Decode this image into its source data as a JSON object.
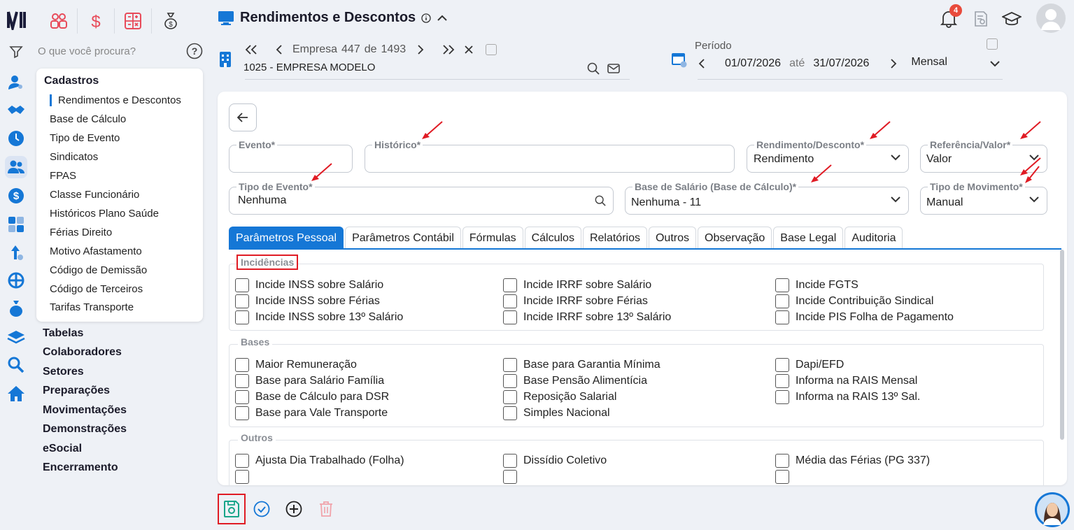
{
  "shortcuts": [
    {
      "name": "colaboradores-shortcut",
      "icon": "people-icon"
    },
    {
      "name": "financeiro-shortcut",
      "icon": "dollar-icon"
    },
    {
      "name": "calculadora-shortcut",
      "icon": "calculator-icon"
    },
    {
      "name": "money-bag-shortcut",
      "icon": "money-bag-icon"
    }
  ],
  "menu_search": {
    "placeholder": "O que você procura?"
  },
  "submenu": {
    "title": "Cadastros",
    "items": [
      "Rendimentos e Descontos",
      "Base de Cálculo",
      "Tipo de Evento",
      "Sindicatos",
      "FPAS",
      "Classe Funcionário",
      "Históricos Plano Saúde",
      "Férias Direito",
      "Motivo Afastamento",
      "Código de Demissão",
      "Código de Terceiros",
      "Tarifas Transporte"
    ]
  },
  "main_menu": [
    "Tabelas",
    "Colaboradores",
    "Setores",
    "Preparações",
    "Movimentações",
    "Demonstrações",
    "eSocial",
    "Encerramento"
  ],
  "header": {
    "title": "Rendimentos e Descontos",
    "notification_count": "4"
  },
  "empresa": {
    "label": "Empresa",
    "current": "447",
    "de": "de",
    "total": "1493",
    "name": "1025 - EMPRESA MODELO"
  },
  "periodo": {
    "label": "Período",
    "start": "01/07/2026",
    "ate": "até",
    "end": "31/07/2026",
    "mode": "Mensal"
  },
  "form": {
    "evento": {
      "label": "Evento*",
      "value": ""
    },
    "historico": {
      "label": "Histórico*",
      "value": ""
    },
    "rendimento_desconto": {
      "label": "Rendimento/Desconto*",
      "value": "Rendimento"
    },
    "referencia_valor": {
      "label": "Referência/Valor*",
      "value": "Valor"
    },
    "tipo_evento": {
      "label": "Tipo de Evento*",
      "value": "Nenhuma"
    },
    "base_salario": {
      "label": "Base de Salário (Base de Cálculo)*",
      "value": "Nenhuma - 11"
    },
    "tipo_movimento": {
      "label": "Tipo de Movimento*",
      "value": "Manual"
    }
  },
  "tabs": [
    "Parâmetros Pessoal",
    "Parâmetros Contábil",
    "Fórmulas",
    "Cálculos",
    "Relatórios",
    "Outros",
    "Observação",
    "Base Legal",
    "Auditoria"
  ],
  "sections": {
    "incidencias": {
      "title": "Incidências",
      "col1": [
        "Incide INSS sobre Salário",
        "Incide INSS sobre Férias",
        "Incide INSS sobre 13º Salário"
      ],
      "col2": [
        "Incide IRRF sobre Salário",
        "Incide IRRF sobre Férias",
        "Incide IRRF sobre 13º Salário"
      ],
      "col3": [
        "Incide FGTS",
        "Incide Contribuição Sindical",
        "Incide PIS Folha de Pagamento"
      ]
    },
    "bases": {
      "title": "Bases",
      "col1": [
        "Maior Remuneração",
        "Base para Salário Família",
        "Base de Cálculo para DSR",
        "Base para Vale Transporte"
      ],
      "col2": [
        "Base para Garantia Mínima",
        "Base Pensão Alimentícia",
        "Reposição Salarial",
        "Simples Nacional"
      ],
      "col3": [
        "Dapi/EFD",
        "Informa na RAIS Mensal",
        "Informa na RAIS 13º Sal."
      ]
    },
    "outros": {
      "title": "Outros",
      "col1": [
        "Ajusta Dia Trabalhado (Folha)"
      ],
      "col2": [
        "Dissídio Coletivo"
      ],
      "col3": [
        "Média das Férias (PG 337)"
      ]
    }
  },
  "colors": {
    "accent": "#1577d6",
    "highlight": "#e01b24",
    "save": "#17a589"
  }
}
